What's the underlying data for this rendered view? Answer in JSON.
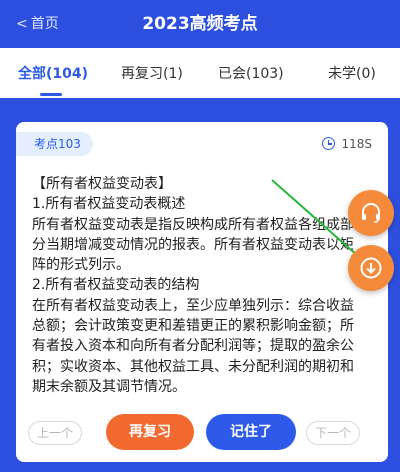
{
  "header": {
    "back_label": "首页",
    "back_icon": "<",
    "title": "2023高频考点"
  },
  "tabs": [
    {
      "label": "全部(104)",
      "active": true
    },
    {
      "label": "再复习(1)",
      "active": false
    },
    {
      "label": "已会(103)",
      "active": false
    },
    {
      "label": "未学(0)",
      "active": false
    }
  ],
  "card": {
    "tag": "考点103",
    "timer": "118S",
    "lines": [
      "【所有者权益变动表】",
      "1.所有者权益变动表概述",
      "所有者权益变动表是指反映构成所有者权益各组成部分当期增减变动情况的报表。所有者权益变动表以矩阵的形式列示。",
      "2.所有者权益变动表的结构",
      "在所有者权益变动表上，至少应单独列示：综合收益总额；会计政策变更和差错更正的累积影响金额；所有者投入资本和向所有者分配利润等；提取的盈余公积；实收资本、其他权益工具、未分配利润的期初和期末余额及其调节情况。"
    ],
    "buttons": {
      "prev": "上一个",
      "review": "再复习",
      "remember": "记住了",
      "next": "下一个"
    }
  },
  "colors": {
    "brand_blue": "#2d4fe0",
    "accent_orange": "#f58a3a",
    "review_orange": "#f36a30",
    "annotation_green": "#27b53a"
  },
  "floating": {
    "headset_icon": "headset-icon",
    "download_icon": "download-icon"
  }
}
